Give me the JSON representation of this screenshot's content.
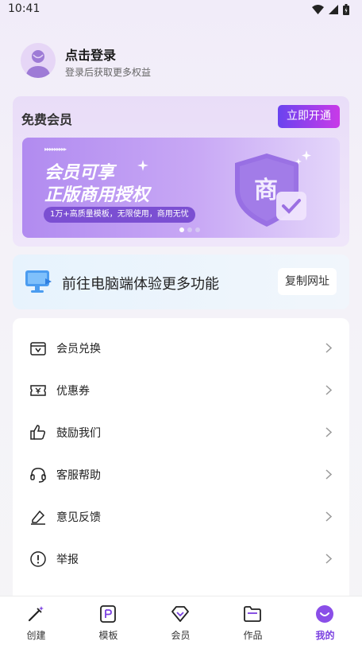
{
  "status_bar": {
    "time": "10:41"
  },
  "profile": {
    "title": "点击登录",
    "subtitle": "登录后获取更多权益"
  },
  "member_card": {
    "title": "免费会员",
    "open_button": "立即开通",
    "banner": {
      "line1": "会员可享",
      "line2": "正版商用授权",
      "pill": "1万+高质量模板，无限使用，商用无忧",
      "shield_char": "商"
    }
  },
  "pc_card": {
    "text": "前往电脑端体验更多功能",
    "copy_button": "复制网址"
  },
  "menu": {
    "items": [
      {
        "label": "会员兑换",
        "icon": "member-exchange-icon"
      },
      {
        "label": "优惠券",
        "icon": "coupon-icon"
      },
      {
        "label": "鼓励我们",
        "icon": "thumbs-up-icon"
      },
      {
        "label": "客服帮助",
        "icon": "headset-icon"
      },
      {
        "label": "意见反馈",
        "icon": "feedback-icon"
      },
      {
        "label": "举报",
        "icon": "report-icon"
      }
    ]
  },
  "tabs": [
    {
      "label": "创建",
      "icon": "magic-wand-icon"
    },
    {
      "label": "模板",
      "icon": "template-icon"
    },
    {
      "label": "会员",
      "icon": "diamond-icon"
    },
    {
      "label": "作品",
      "icon": "folder-icon"
    },
    {
      "label": "我的",
      "icon": "profile-icon",
      "active": true
    }
  ],
  "colors": {
    "accent": "#7a3fe0",
    "button_gradient_start": "#6a43ef",
    "button_gradient_end": "#c93ae8"
  }
}
